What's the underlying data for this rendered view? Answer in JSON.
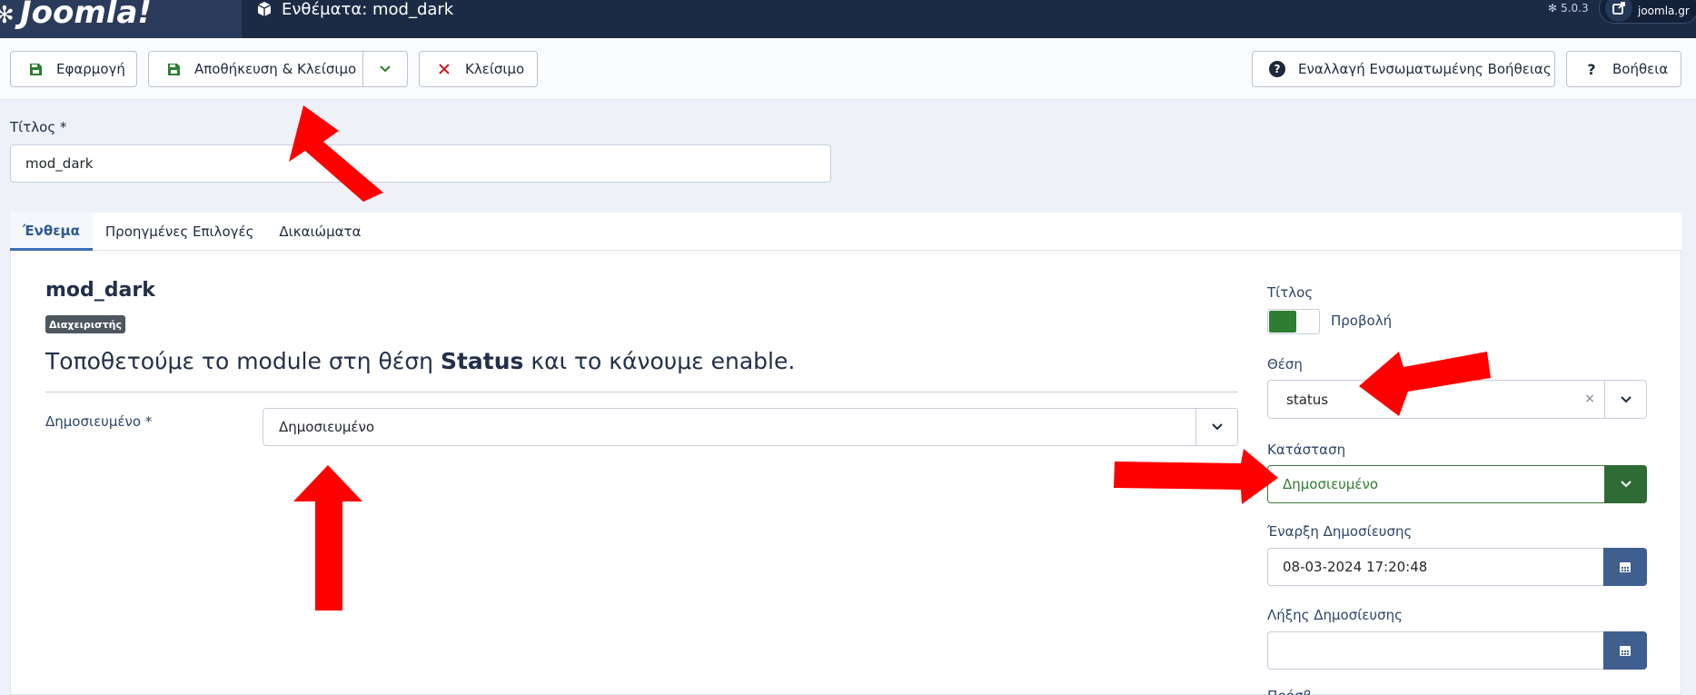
{
  "header": {
    "logo_text": "Joomla!",
    "page_title": "Ενθέματα: mod_dark",
    "version": "5.0.3",
    "site_link": "joomla.gr"
  },
  "toolbar": {
    "apply_label": "Εφαρμογή",
    "save_close_label": "Αποθήκευση & Κλείσιμο",
    "close_label": "Κλείσιμο",
    "inline_help_label": "Εναλλαγή Ενσωματωμένης Βοήθειας",
    "help_label": "Βοήθεια"
  },
  "title_field": {
    "label": "Τίτλος *",
    "value": "mod_dark"
  },
  "tabs": [
    {
      "label": "Ένθεμα",
      "active": true
    },
    {
      "label": "Προηγμένες Επιλογές",
      "active": false
    },
    {
      "label": "Δικαιώματα",
      "active": false
    }
  ],
  "module": {
    "name": "mod_dark",
    "badge": "Διαχειριστής",
    "annotation_before": "Τοποθετούμε το module στη θέση ",
    "annotation_bold": "Status",
    "annotation_after": " και το κάνουμε enable.",
    "published_label": "Δημοσιευμένο *",
    "published_value": "Δημοσιευμένο"
  },
  "sidebar": {
    "title_label": "Τίτλος",
    "title_toggle_text": "Προβολή",
    "position_label": "Θέση",
    "position_value": "status",
    "state_label": "Κατάσταση",
    "state_value": "Δημοσιευμένο",
    "publish_up_label": "Έναρξη Δημοσίευσης",
    "publish_up_value": "08-03-2024 17:20:48",
    "publish_down_label": "Λήξης Δημοσίευσης",
    "publish_down_value": ""
  },
  "colors": {
    "header_bg": "#1c2b45",
    "success_green": "#2f7d32",
    "calendar_blue": "#3f5f8f",
    "arrow_red": "#ff0000"
  }
}
